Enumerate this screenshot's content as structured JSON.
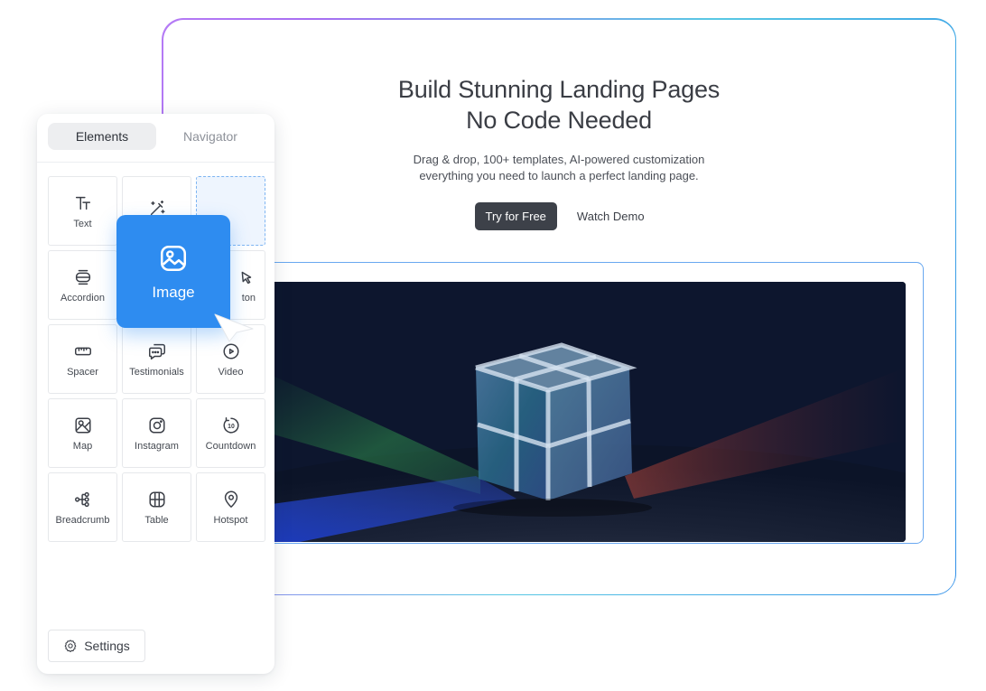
{
  "hero": {
    "title_line1": "Build Stunning Landing Pages",
    "title_line2": "No Code Needed",
    "subtitle_line1": "Drag & drop, 100+ templates, AI-powered customization",
    "subtitle_line2": "everything you need to launch a perfect landing page.",
    "primary_cta": "Try for Free",
    "secondary_cta": "Watch Demo"
  },
  "panel": {
    "tabs": [
      {
        "label": "Elements",
        "active": true
      },
      {
        "label": "Navigator",
        "active": false
      }
    ],
    "elements": [
      {
        "label": "Text",
        "icon": "text-icon"
      },
      {
        "label": "",
        "icon": "magic-wand-icon"
      },
      {
        "label": "",
        "icon": "",
        "dropzone": true
      },
      {
        "label": "Accordion",
        "icon": "accordion-icon"
      },
      {
        "label": "",
        "icon": ""
      },
      {
        "label": "ton",
        "icon": "button-pointer-icon"
      },
      {
        "label": "Spacer",
        "icon": "spacer-icon"
      },
      {
        "label": "Testimonials",
        "icon": "testimonials-icon"
      },
      {
        "label": "Video",
        "icon": "video-icon"
      },
      {
        "label": "Map",
        "icon": "map-icon"
      },
      {
        "label": "Instagram",
        "icon": "instagram-icon"
      },
      {
        "label": "Countdown",
        "icon": "countdown-icon"
      },
      {
        "label": "Breadcrumb",
        "icon": "breadcrumb-icon"
      },
      {
        "label": "Table",
        "icon": "table-icon"
      },
      {
        "label": "Hotspot",
        "icon": "hotspot-icon"
      }
    ],
    "settings_label": "Settings"
  },
  "drag_card": {
    "label": "Image",
    "icon": "image-icon"
  },
  "colors": {
    "accent": "#2e8cf0",
    "primary_button": "#3d4149",
    "frame_gradient_start": "#b57bf5",
    "frame_gradient_end": "#2f8fe8"
  }
}
